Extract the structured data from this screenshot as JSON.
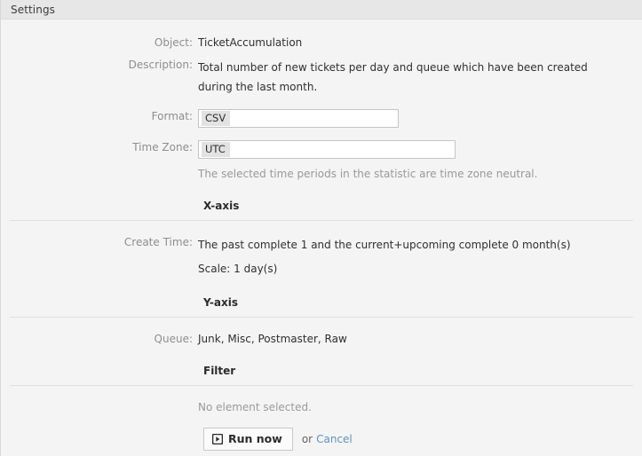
{
  "window": {
    "title": "Settings"
  },
  "fields": {
    "object": {
      "label": "Object:",
      "value": "TicketAccumulation"
    },
    "description": {
      "label": "Description:",
      "value": "Total number of new tickets per day and queue which have been created during the last month."
    },
    "format": {
      "label": "Format:",
      "selected": "CSV"
    },
    "timezone": {
      "label": "Time Zone:",
      "selected": "UTC",
      "hint": "The selected time periods in the statistic are time zone neutral."
    }
  },
  "sections": {
    "xaxis": {
      "title": "X-axis",
      "create_time": {
        "label": "Create Time:",
        "line1": "The past complete 1 and the current+upcoming complete 0 month(s)",
        "line2": "Scale: 1 day(s)"
      }
    },
    "yaxis": {
      "title": "Y-axis",
      "queue": {
        "label": "Queue:",
        "value": "Junk, Misc, Postmaster, Raw"
      }
    },
    "filter": {
      "title": "Filter",
      "empty_text": "No element selected."
    }
  },
  "footer": {
    "run_label": "Run now",
    "or_label": "or",
    "cancel_label": "Cancel",
    "run_icon": "play-icon"
  },
  "colors": {
    "link": "#5f93c4",
    "header_bg": "#e7e7e7",
    "body_bg": "#f4f4f4",
    "tag_bg": "#e2e2e2"
  }
}
